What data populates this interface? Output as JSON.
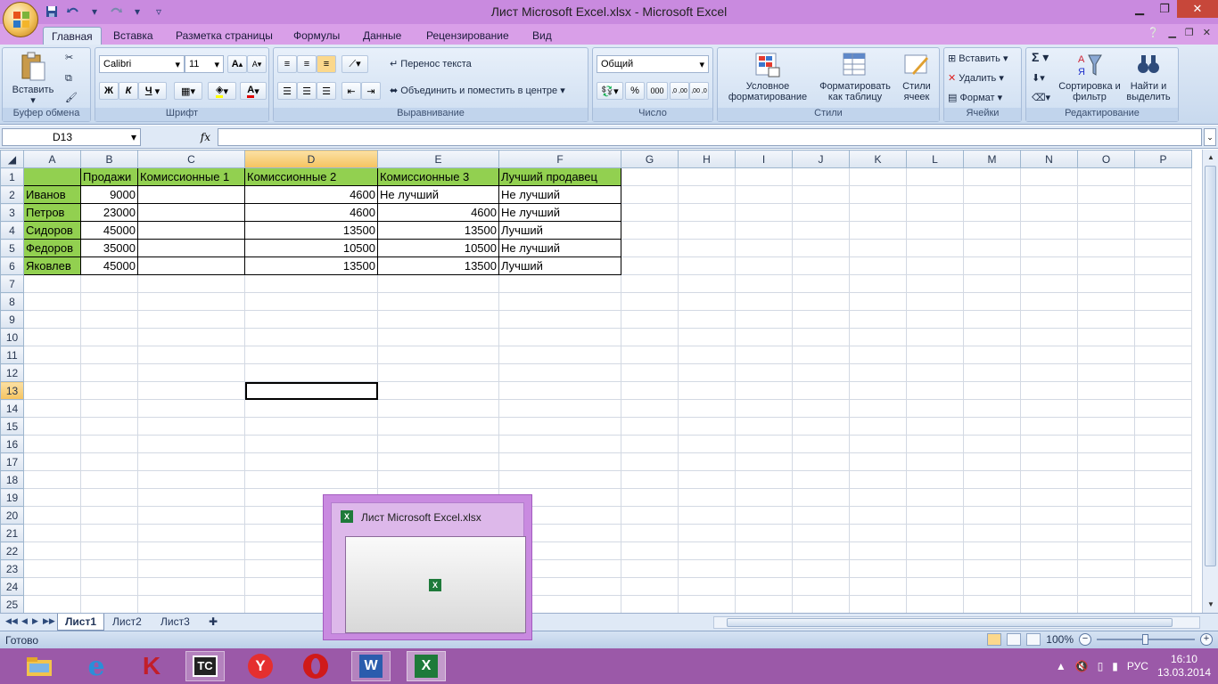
{
  "window": {
    "title": "Лист Microsoft Excel.xlsx - Microsoft Excel",
    "controls": [
      "minimize",
      "restore",
      "close"
    ]
  },
  "qat": {
    "items": [
      "save-icon",
      "undo-icon",
      "redo-icon",
      "customize-icon"
    ]
  },
  "ribbon": {
    "tabs": [
      "Главная",
      "Вставка",
      "Разметка страницы",
      "Формулы",
      "Данные",
      "Рецензирование",
      "Вид"
    ],
    "active_tab": "Главная",
    "clipboard": {
      "label": "Буфер обмена",
      "paste": "Вставить"
    },
    "font": {
      "label": "Шрифт",
      "name": "Calibri",
      "size": "11",
      "bold": "Ж",
      "italic": "К",
      "underline": "Ч",
      "grow": "A",
      "shrink": "A",
      "color": "A"
    },
    "alignment": {
      "label": "Выравнивание",
      "wrap": "Перенос текста",
      "merge": "Объединить и поместить в центре"
    },
    "number": {
      "label": "Число",
      "format": "Общий",
      "percent": "%",
      "thousands": "000",
      "inc_dec": ",0 ,00",
      "dec_dec": ",00 ,0"
    },
    "styles": {
      "label": "Стили",
      "conditional": "Условное форматирование",
      "as_table": "Форматировать как таблицу",
      "cell_styles": "Стили ячеек"
    },
    "cells": {
      "label": "Ячейки",
      "insert": "Вставить",
      "delete": "Удалить",
      "format": "Формат"
    },
    "editing": {
      "label": "Редактирование",
      "sort": "Сортировка и фильтр",
      "find": "Найти и выделить",
      "sum": "Σ"
    }
  },
  "formula_bar": {
    "name_box": "D13",
    "fx": "fx",
    "value": ""
  },
  "grid": {
    "columns": [
      "A",
      "B",
      "C",
      "D",
      "E",
      "F",
      "G",
      "H",
      "I",
      "J",
      "K",
      "L",
      "M",
      "N",
      "O",
      "P"
    ],
    "selected_column": "D",
    "selected_row": 13,
    "selected_cell": "D13",
    "header_row": [
      "",
      "Продажи",
      "Комиссионные 1",
      "Комиссионные 2",
      "Комиссионные 3",
      "Лучший продавец"
    ],
    "rows": [
      [
        "Иванов",
        "9000",
        "",
        "4600",
        "Не лучший",
        "Не лучший"
      ],
      [
        "Петров",
        "23000",
        "",
        "4600",
        "4600",
        "Не лучший"
      ],
      [
        "Сидоров",
        "45000",
        "",
        "13500",
        "13500",
        "Лучший"
      ],
      [
        "Федоров",
        "35000",
        "",
        "10500",
        "10500",
        "Не лучший"
      ],
      [
        "Яковлев",
        "45000",
        "",
        "13500",
        "13500",
        "Лучший"
      ]
    ],
    "row_count": 25
  },
  "sheets": {
    "tabs": [
      "Лист1",
      "Лист2",
      "Лист3"
    ],
    "active": "Лист1"
  },
  "status": {
    "text": "Готово",
    "zoom": "100%"
  },
  "thumbnail": {
    "title": "Лист Microsoft Excel.xlsx"
  },
  "taskbar": {
    "apps": [
      "file-explorer-icon",
      "internet-explorer-icon",
      "kaspersky-icon",
      "total-commander-icon",
      "yandex-browser-icon",
      "opera-icon",
      "word-icon",
      "excel-icon"
    ],
    "language": "РУС",
    "time": "16:10",
    "date": "13.03.2014"
  }
}
